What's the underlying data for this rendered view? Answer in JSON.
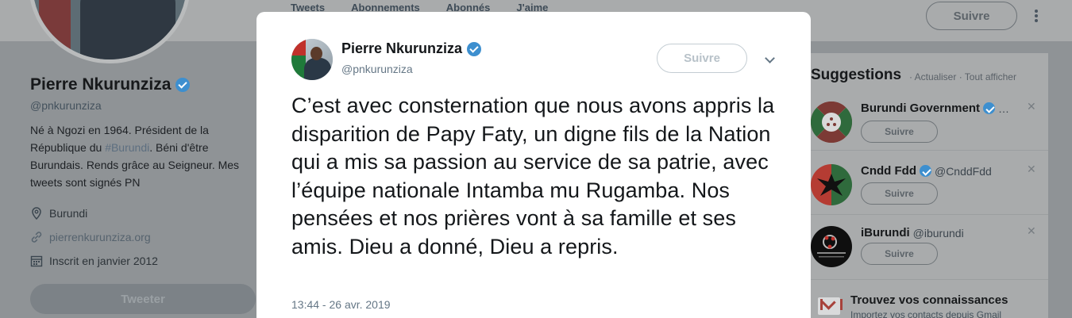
{
  "nav": {
    "tabs": [
      "Tweets",
      "Abonnements",
      "Abonnés",
      "J'aime"
    ],
    "follow_label": "Suivre"
  },
  "profile": {
    "name": "Pierre Nkurunziza",
    "handle": "@pnkurunziza",
    "bio_pre": "Né à Ngozi en 1964. Président de la République du ",
    "bio_tag": "#Burundi",
    "bio_post": ". Béni d'être Burundais. Rends grâce au Seigneur. Mes tweets sont signés PN",
    "location": "Burundi",
    "website": "pierrenkurunziza.org",
    "joined": "Inscrit en janvier 2012",
    "tweet_button": "Tweeter"
  },
  "suggestions": {
    "title": "Suggestions",
    "links": "· Actualiser · Tout afficher",
    "items": [
      {
        "name": "Burundi Government",
        "handle": "…",
        "follow": "Suivre"
      },
      {
        "name": "Cndd Fdd",
        "handle": "@CnddFdd",
        "follow": "Suivre"
      },
      {
        "name": "iBurundi",
        "handle": "@iburundi",
        "follow": "Suivre"
      }
    ],
    "find": {
      "title": "Trouvez vos connaissances",
      "subtitle": "Importez vos contacts depuis Gmail"
    }
  },
  "modal": {
    "name": "Pierre Nkurunziza",
    "handle": "@pnkurunziza",
    "follow_label": "Suivre",
    "text": "C’est avec consternation que nous avons appris la disparition de Papy Faty, un digne fils de la Nation qui a mis sa passion au service de sa patrie, avec l’équipe nationale Intamba mu Rugamba. Nos pensées et nos prières vont à sa famille et ses amis. Dieu a donné, Dieu a repris.",
    "timestamp": "13:44 - 26 avr. 2019"
  },
  "colors": {
    "verified": "#3d8fcf",
    "overlay": "#8f9396",
    "modal_bg": "#ffffff"
  }
}
